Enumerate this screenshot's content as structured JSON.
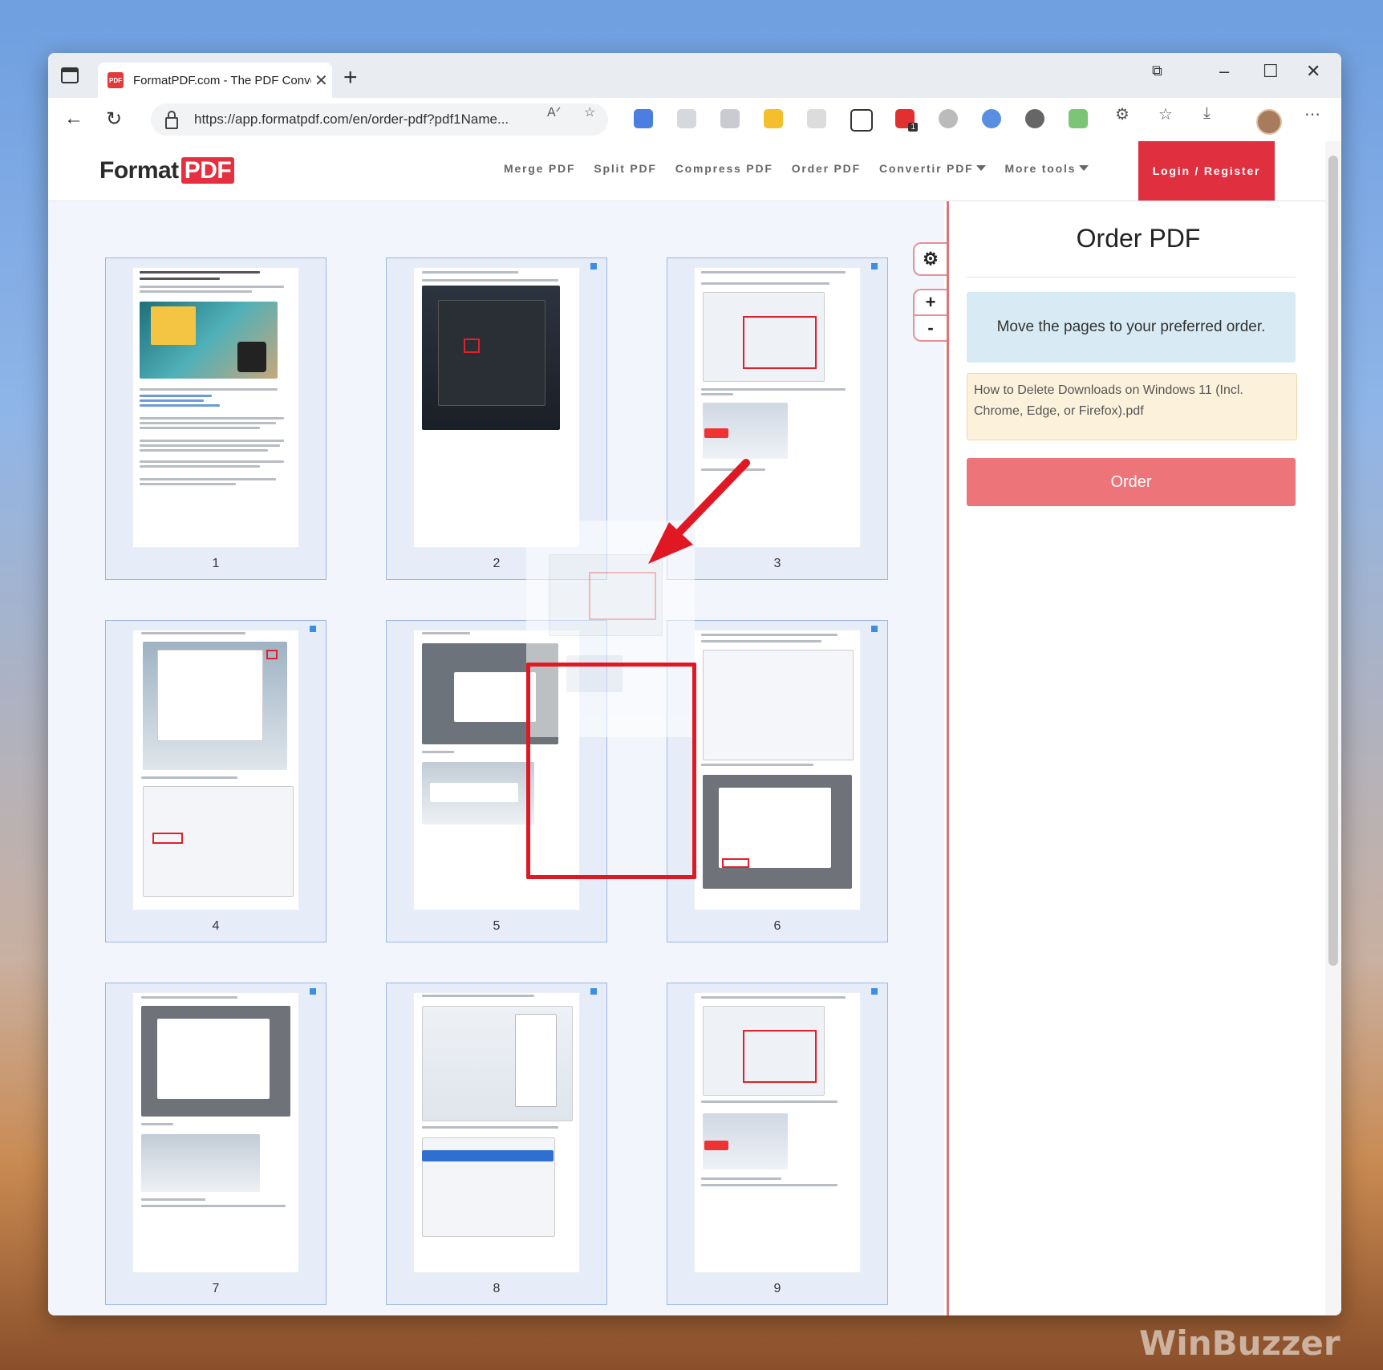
{
  "browser": {
    "tab_title": "FormatPDF.com - The PDF Conve",
    "tab_favicon_text": "PDF",
    "url": "https://app.formatpdf.com/en/order-pdf?pdf1Name...",
    "icons": [
      "sidebar-toggle-icon",
      "close-icon",
      "new-tab-icon",
      "minimize-icon",
      "maximize-icon",
      "window-close-icon",
      "back-icon",
      "refresh-icon",
      "lock-icon",
      "read-aloud-icon",
      "add-favorite-icon",
      "translate-icon",
      "favorites-icon",
      "downloads-icon",
      "more-icon"
    ],
    "ext_badge": "1"
  },
  "site": {
    "logo_text": "Format",
    "logo_pdf": "PDF",
    "nav": [
      "Merge PDF",
      "Split PDF",
      "Compress PDF",
      "Order PDF",
      "Convertir PDF",
      "More tools"
    ],
    "login": "Login / Register",
    "accent": "#e0303f"
  },
  "pages": [
    "1",
    "2",
    "3",
    "4",
    "5",
    "6",
    "7",
    "8",
    "9"
  ],
  "panel": {
    "title": "Order PDF",
    "info": "Move the pages to your preferred order.",
    "filename": "How to Delete Downloads on Windows 11 (Incl. Chrome, Edge, or Firefox).pdf",
    "order_button": "Order",
    "order_color": "#ed7478"
  },
  "controls": {
    "settings": "gear-icon",
    "zoom_in": "+",
    "zoom_out": "-"
  },
  "watermark": "WinBuzzer"
}
